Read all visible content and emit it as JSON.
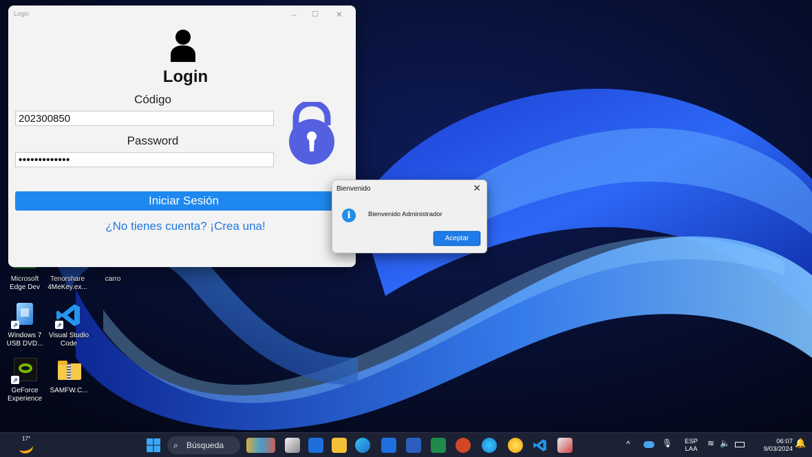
{
  "login_window": {
    "title": "Login",
    "heading": "Login",
    "codigo_label": "Código",
    "codigo_value": "202300850",
    "password_label": "Password",
    "password_value": "•••••••••••••",
    "login_button": "Iniciar Sesión",
    "register_link": "¿No tienes cuenta? ¡Crea una!",
    "accent_color": "#1e88f0",
    "lock_color": "#5560e0"
  },
  "dialog": {
    "title": "Bienvenido",
    "message": "Bienvenido Administrador",
    "ok_button": "Aceptar",
    "icon": "info-icon"
  },
  "desktop_icons": [
    {
      "label": "Microsoft Edge Dev",
      "icon": "edge-dev-icon"
    },
    {
      "label": "Tenorshare 4MeKey.ex...",
      "icon": "tenorshare-icon"
    },
    {
      "label": "carro",
      "icon": "folder-icon"
    },
    {
      "label": "Windows 7 USB DVD...",
      "icon": "windows-usb-tool-icon"
    },
    {
      "label": "Visual Studio Code",
      "icon": "vscode-icon"
    },
    {
      "label": "GeForce Experience",
      "icon": "geforce-icon"
    },
    {
      "label": "SAMFW.C...",
      "icon": "folder-zip-icon"
    }
  ],
  "taskbar": {
    "weather_temp": "17°",
    "search_placeholder": "Búsqueda",
    "language_top": "ESP",
    "language_bottom": "LAA",
    "time": "06:07",
    "date": "9/03/2024"
  }
}
